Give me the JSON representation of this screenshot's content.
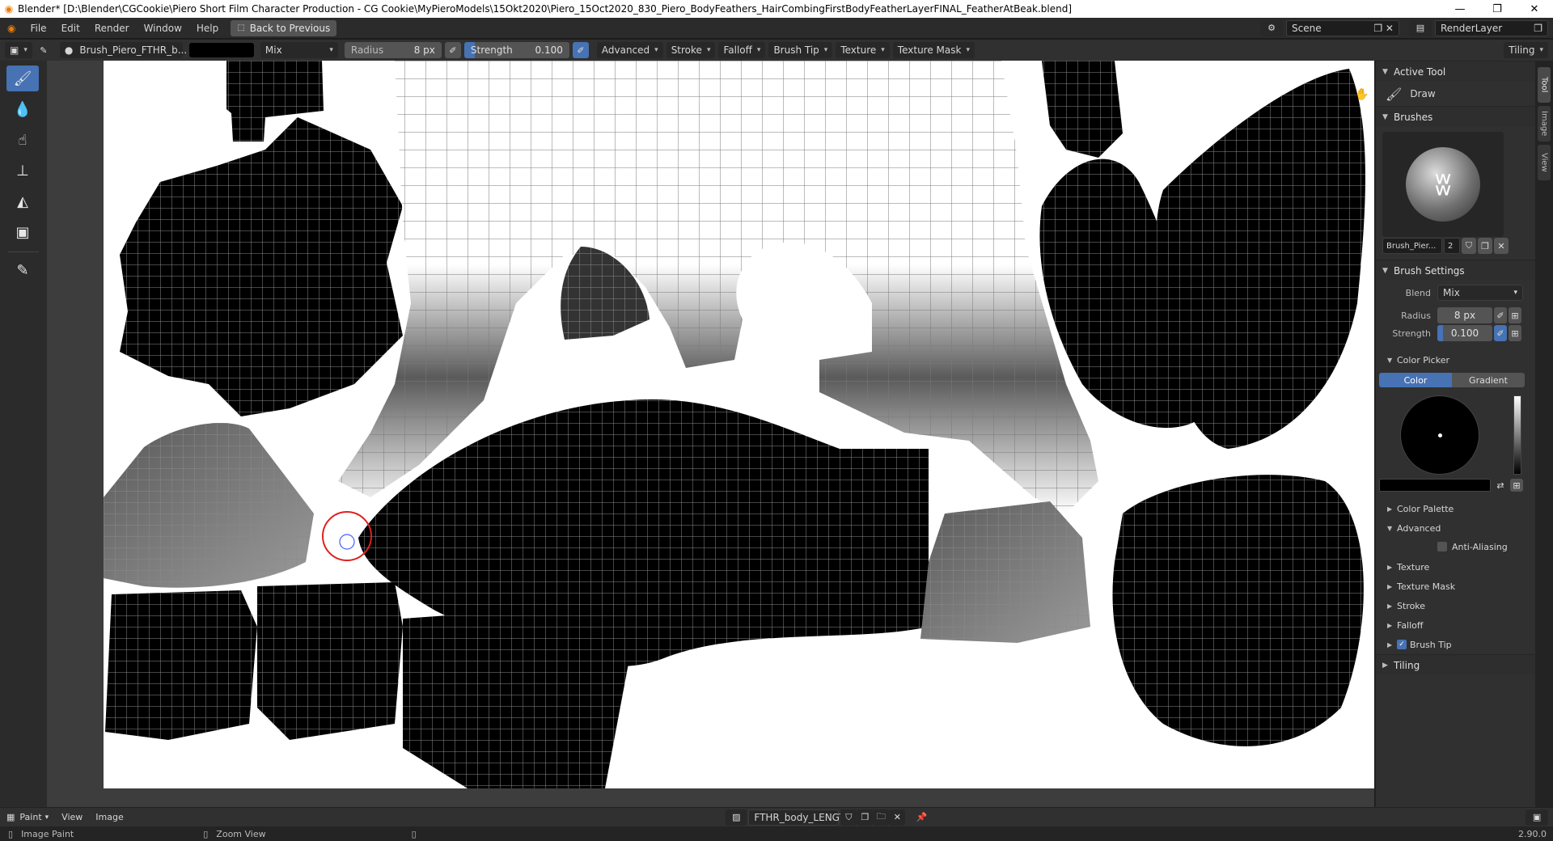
{
  "window": {
    "title": "Blender* [D:\\Blender\\CGCookie\\Piero Short Film Character Production - CG Cookie\\MyPieroModels\\15Okt2020\\Piero_15Oct2020_830_Piero_BodyFeathers_HairCombingFirstBodyFeatherLayerFINAL_FeatherAtBeak.blend]",
    "min": "—",
    "max": "❐",
    "close": "✕"
  },
  "menu": {
    "items": [
      "File",
      "Edit",
      "Render",
      "Window",
      "Help"
    ],
    "back": "Back to Previous",
    "scene_label": "Scene",
    "renderlayer_label": "RenderLayer"
  },
  "toolheader": {
    "brush_name": "Brush_Piero_FTHR_b...",
    "blend": "Mix",
    "radius_label": "Radius",
    "radius_value": "8 px",
    "strength_label": "Strength",
    "strength_value": "0.100",
    "menus": [
      "Advanced",
      "Stroke",
      "Falloff",
      "Brush Tip",
      "Texture",
      "Texture Mask"
    ],
    "tiling": "Tiling"
  },
  "sidebar": {
    "active_tool": "Active Tool",
    "tool_name": "Draw",
    "brushes": "Brushes",
    "brush_short": "Brush_Pier...",
    "brush_users": "2",
    "brush_settings": "Brush Settings",
    "blend_label": "Blend",
    "blend_value": "Mix",
    "radius_label": "Radius",
    "radius_value": "8 px",
    "strength_label": "Strength",
    "strength_value": "0.100",
    "color_picker": "Color Picker",
    "tab_color": "Color",
    "tab_gradient": "Gradient",
    "color_palette": "Color Palette",
    "advanced": "Advanced",
    "anti_aliasing": "Anti-Aliasing",
    "collapsed": [
      "Texture",
      "Texture Mask",
      "Stroke",
      "Falloff"
    ],
    "brush_tip": "Brush Tip",
    "tiling": "Tiling"
  },
  "tabs": [
    "Tool",
    "Image",
    "View"
  ],
  "footer": {
    "mode": "Paint",
    "view": "View",
    "image": "Image",
    "image_name": "FTHR_body_LENGTH"
  },
  "status": {
    "left": "Image Paint",
    "middle": "Zoom View",
    "version": "2.90.0"
  },
  "colors": {
    "accent": "#4772b3",
    "brush_circle": "#e02020"
  }
}
